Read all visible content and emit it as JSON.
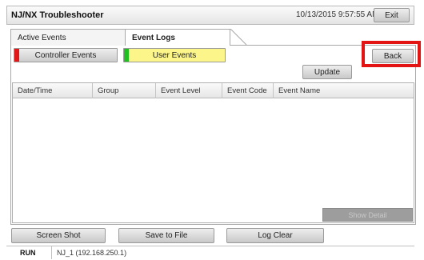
{
  "window": {
    "title": "NJ/NX Troubleshooter",
    "datetime": "10/13/2015 9:57:55 AM",
    "exit_label": "Exit"
  },
  "tabs": [
    {
      "label": "Active Events",
      "active": false
    },
    {
      "label": "Event Logs",
      "active": true
    }
  ],
  "subtabs": {
    "controller_events": "Controller Events",
    "user_events": "User Events"
  },
  "buttons": {
    "back": "Back",
    "update": "Update",
    "show_detail": "Show Detail",
    "screen_shot": "Screen Shot",
    "save_to_file": "Save to File",
    "log_clear": "Log Clear"
  },
  "table": {
    "columns": [
      "Date/Time",
      "Group",
      "Event Level",
      "Event Code",
      "Event Name"
    ],
    "rows": []
  },
  "status": {
    "mode": "RUN",
    "controller": "NJ_1 (192.168.250.1)"
  },
  "colors": {
    "controller_marker": "#e01818",
    "user_marker": "#21bf21",
    "user_events_bg": "#fbf58a",
    "highlight_frame": "#e31414"
  }
}
